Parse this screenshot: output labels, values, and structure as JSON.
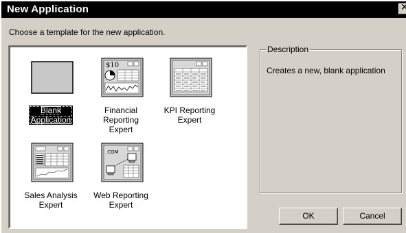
{
  "window": {
    "title": "New Application",
    "close_glyph": "✕"
  },
  "instruction": "Choose a template for the new application.",
  "templates": [
    {
      "line1": "Blank",
      "line2": "Application",
      "icon": "blank-application-icon",
      "selected": true
    },
    {
      "line1": "Financial",
      "line2": "Reporting Expert",
      "icon": "financial-reporting-icon",
      "icon_text": "$10",
      "selected": false
    },
    {
      "line1": "KPI Reporting",
      "line2": "Expert",
      "icon": "kpi-reporting-icon",
      "selected": false
    },
    {
      "line1": "Sales Analysis",
      "line2": "Expert",
      "icon": "sales-analysis-icon",
      "selected": false
    },
    {
      "line1": "Web Reporting",
      "line2": "Expert",
      "icon": "web-reporting-icon",
      "icon_text": ".COM",
      "selected": false
    }
  ],
  "description": {
    "legend": "Description",
    "text": "Creates a new, blank application"
  },
  "buttons": {
    "ok": "OK",
    "cancel": "Cancel"
  },
  "colors": {
    "face": "#d4d0c8",
    "titlebar": "#000000",
    "selection": "#000000"
  }
}
